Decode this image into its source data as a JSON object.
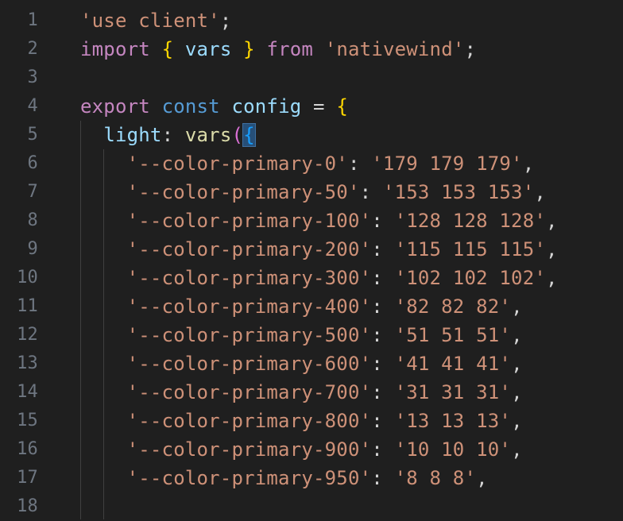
{
  "lines": [
    {
      "n": "1",
      "parts": [
        {
          "t": "'use client'",
          "c": "str"
        },
        {
          "t": ";",
          "c": "op"
        }
      ]
    },
    {
      "n": "2",
      "parts": [
        {
          "t": "import",
          "c": "kw"
        },
        {
          "t": " ",
          "c": "op"
        },
        {
          "t": "{",
          "c": "brace"
        },
        {
          "t": " ",
          "c": "op"
        },
        {
          "t": "vars",
          "c": "var"
        },
        {
          "t": " ",
          "c": "op"
        },
        {
          "t": "}",
          "c": "brace"
        },
        {
          "t": " ",
          "c": "op"
        },
        {
          "t": "from",
          "c": "kw"
        },
        {
          "t": " ",
          "c": "op"
        },
        {
          "t": "'nativewind'",
          "c": "str"
        },
        {
          "t": ";",
          "c": "op"
        }
      ]
    },
    {
      "n": "3",
      "parts": []
    },
    {
      "n": "4",
      "parts": [
        {
          "t": "export",
          "c": "kw"
        },
        {
          "t": " ",
          "c": "op"
        },
        {
          "t": "const",
          "c": "kw2"
        },
        {
          "t": " ",
          "c": "op"
        },
        {
          "t": "config",
          "c": "var"
        },
        {
          "t": " = ",
          "c": "op"
        },
        {
          "t": "{",
          "c": "brace"
        }
      ]
    },
    {
      "n": "5",
      "parts": [
        {
          "t": "  ",
          "c": "op"
        },
        {
          "t": "light",
          "c": "var"
        },
        {
          "t": ": ",
          "c": "op"
        },
        {
          "t": "vars",
          "c": "fn"
        },
        {
          "t": "(",
          "c": "brace2"
        },
        {
          "t": "{",
          "c": "brace3",
          "hl": true
        }
      ]
    },
    {
      "n": "6",
      "parts": [
        {
          "t": "    ",
          "c": "op"
        },
        {
          "t": "'--color-primary-0'",
          "c": "str"
        },
        {
          "t": ": ",
          "c": "op"
        },
        {
          "t": "'179 179 179'",
          "c": "str"
        },
        {
          "t": ",",
          "c": "op"
        }
      ]
    },
    {
      "n": "7",
      "parts": [
        {
          "t": "    ",
          "c": "op"
        },
        {
          "t": "'--color-primary-50'",
          "c": "str"
        },
        {
          "t": ": ",
          "c": "op"
        },
        {
          "t": "'153 153 153'",
          "c": "str"
        },
        {
          "t": ",",
          "c": "op"
        }
      ]
    },
    {
      "n": "8",
      "parts": [
        {
          "t": "    ",
          "c": "op"
        },
        {
          "t": "'--color-primary-100'",
          "c": "str"
        },
        {
          "t": ": ",
          "c": "op"
        },
        {
          "t": "'128 128 128'",
          "c": "str"
        },
        {
          "t": ",",
          "c": "op"
        }
      ]
    },
    {
      "n": "9",
      "parts": [
        {
          "t": "    ",
          "c": "op"
        },
        {
          "t": "'--color-primary-200'",
          "c": "str"
        },
        {
          "t": ": ",
          "c": "op"
        },
        {
          "t": "'115 115 115'",
          "c": "str"
        },
        {
          "t": ",",
          "c": "op"
        }
      ]
    },
    {
      "n": "10",
      "parts": [
        {
          "t": "    ",
          "c": "op"
        },
        {
          "t": "'--color-primary-300'",
          "c": "str"
        },
        {
          "t": ": ",
          "c": "op"
        },
        {
          "t": "'102 102 102'",
          "c": "str"
        },
        {
          "t": ",",
          "c": "op"
        }
      ]
    },
    {
      "n": "11",
      "parts": [
        {
          "t": "    ",
          "c": "op"
        },
        {
          "t": "'--color-primary-400'",
          "c": "str"
        },
        {
          "t": ": ",
          "c": "op"
        },
        {
          "t": "'82 82 82'",
          "c": "str"
        },
        {
          "t": ",",
          "c": "op"
        }
      ]
    },
    {
      "n": "12",
      "parts": [
        {
          "t": "    ",
          "c": "op"
        },
        {
          "t": "'--color-primary-500'",
          "c": "str"
        },
        {
          "t": ": ",
          "c": "op"
        },
        {
          "t": "'51 51 51'",
          "c": "str"
        },
        {
          "t": ",",
          "c": "op"
        }
      ]
    },
    {
      "n": "13",
      "parts": [
        {
          "t": "    ",
          "c": "op"
        },
        {
          "t": "'--color-primary-600'",
          "c": "str"
        },
        {
          "t": ": ",
          "c": "op"
        },
        {
          "t": "'41 41 41'",
          "c": "str"
        },
        {
          "t": ",",
          "c": "op"
        }
      ]
    },
    {
      "n": "14",
      "parts": [
        {
          "t": "    ",
          "c": "op"
        },
        {
          "t": "'--color-primary-700'",
          "c": "str"
        },
        {
          "t": ": ",
          "c": "op"
        },
        {
          "t": "'31 31 31'",
          "c": "str"
        },
        {
          "t": ",",
          "c": "op"
        }
      ]
    },
    {
      "n": "15",
      "parts": [
        {
          "t": "    ",
          "c": "op"
        },
        {
          "t": "'--color-primary-800'",
          "c": "str"
        },
        {
          "t": ": ",
          "c": "op"
        },
        {
          "t": "'13 13 13'",
          "c": "str"
        },
        {
          "t": ",",
          "c": "op"
        }
      ]
    },
    {
      "n": "16",
      "parts": [
        {
          "t": "    ",
          "c": "op"
        },
        {
          "t": "'--color-primary-900'",
          "c": "str"
        },
        {
          "t": ": ",
          "c": "op"
        },
        {
          "t": "'10 10 10'",
          "c": "str"
        },
        {
          "t": ",",
          "c": "op"
        }
      ]
    },
    {
      "n": "17",
      "parts": [
        {
          "t": "    ",
          "c": "op"
        },
        {
          "t": "'--color-primary-950'",
          "c": "str"
        },
        {
          "t": ": ",
          "c": "op"
        },
        {
          "t": "'8 8 8'",
          "c": "str"
        },
        {
          "t": ",",
          "c": "op"
        }
      ]
    },
    {
      "n": "18",
      "parts": []
    }
  ],
  "colors": {
    "background": "#1f1f1f",
    "line_number": "#6e7681",
    "keyword": "#c586c0",
    "string": "#ce9178",
    "variable": "#9cdcfe",
    "function": "#dcdcaa",
    "bracket_level1": "#ffd700",
    "bracket_level2": "#da70d6",
    "bracket_level3": "#179fff"
  }
}
